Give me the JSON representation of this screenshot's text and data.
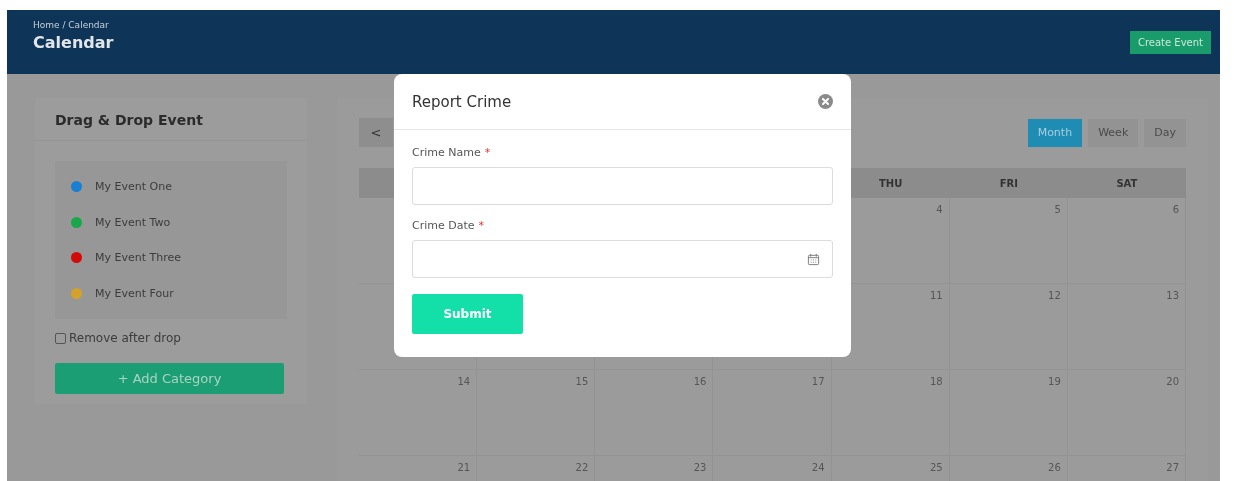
{
  "header": {
    "breadcrumb": "Home / Calendar",
    "title": "Calendar",
    "action": "Create Event"
  },
  "sidebar": {
    "title": "Drag & Drop Event",
    "events": [
      {
        "label": "My Event One",
        "color": "#1a7fd0"
      },
      {
        "label": "My Event Two",
        "color": "#18a84a"
      },
      {
        "label": "My Event Three",
        "color": "#d20a0a"
      },
      {
        "label": "My Event Four",
        "color": "#d4a22a"
      }
    ],
    "remove_after_drop": {
      "label": "Remove after drop",
      "checked": false
    },
    "add_button": "+ Add Category"
  },
  "calendar": {
    "prev": "<",
    "views": [
      {
        "label": "Month",
        "selected": true
      },
      {
        "label": "Week",
        "selected": false
      },
      {
        "label": "Day",
        "selected": false
      }
    ],
    "weekdays": [
      "THU",
      "FRI",
      "SAT"
    ],
    "weeks": [
      {
        "days": [
          "4",
          "5",
          "6"
        ]
      },
      {
        "days": [
          "11",
          "12",
          "13"
        ]
      },
      {
        "days": [
          "14",
          "15",
          "16",
          "17",
          "18",
          "19",
          "20"
        ]
      },
      {
        "days": [
          "21",
          "22",
          "23",
          "24",
          "25",
          "26",
          "27"
        ]
      }
    ]
  },
  "modal": {
    "title": "Report Crime",
    "fields": [
      {
        "label": "Crime Name",
        "required": true,
        "kind": "text"
      },
      {
        "label": "Crime Date",
        "required": true,
        "kind": "date"
      }
    ],
    "required_mark": "*",
    "submit": "Submit"
  }
}
